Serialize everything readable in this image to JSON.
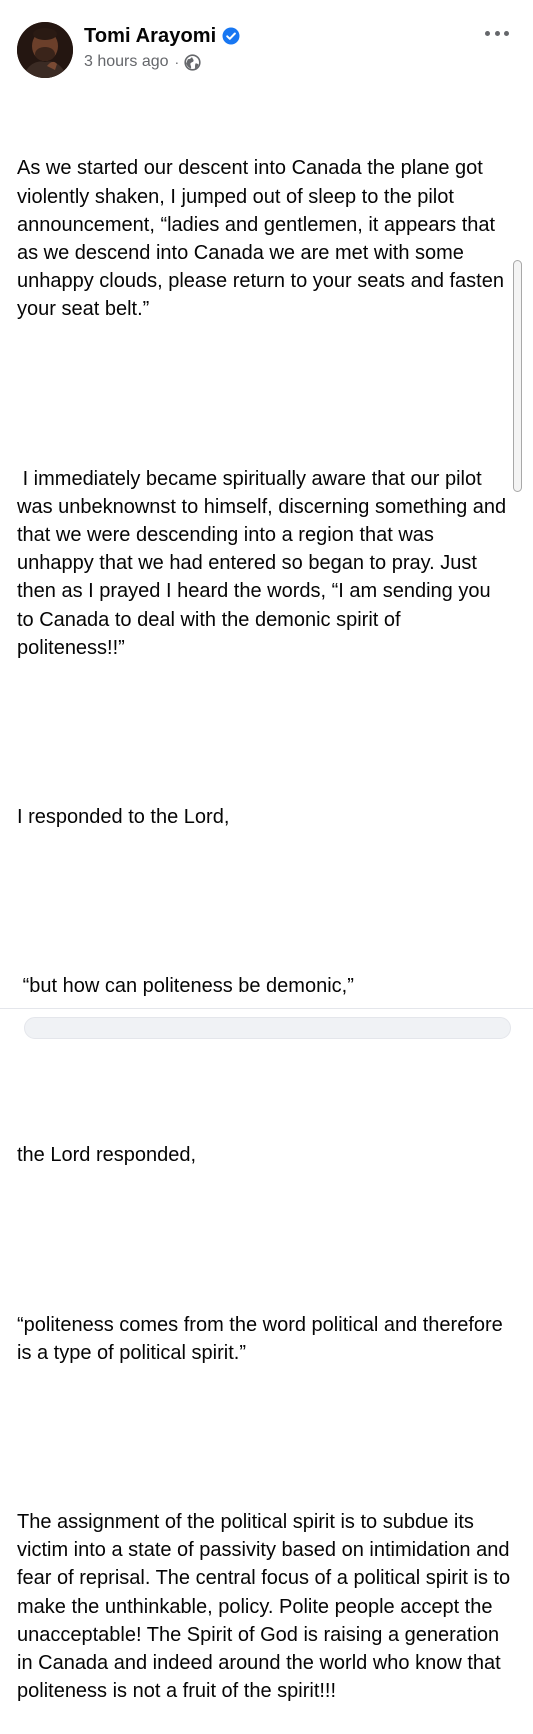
{
  "post": {
    "author": "Tomi Arayomi",
    "timestamp": "3 hours ago",
    "separator": "·",
    "verified_icon": "verified-badge-icon",
    "privacy_icon": "globe-icon",
    "paragraphs": [
      "As we started our descent into Canada the plane got violently shaken, I jumped out of sleep to the pilot announcement, “ladies and gentlemen, it appears that as we descend into Canada we are met with some unhappy clouds, please return to your seats and fasten your seat belt.”",
      " I immediately became spiritually aware that our pilot was unbeknownst to himself, discerning something and that we were descending into a region that was unhappy that we had entered so began to pray. Just then as I prayed I heard the words, “I am sending you to Canada to deal with the demonic spirit of politeness!!”",
      "I responded to the Lord,",
      " “but how can politeness be demonic,”",
      "the Lord responded,",
      "“politeness comes from the word political and therefore is a type of political spirit.”",
      "The assignment of the political spirit is to subdue its victim into a state of passivity based on intimidation and fear of reprisal. The central focus of a political spirit is to make the unthinkable, policy. Polite people accept the unacceptable! The Spirit of God is raising a generation in Canada and indeed around the world who know that politeness is not a fruit of the spirit!!!"
    ]
  },
  "colors": {
    "verified": "#1877f2",
    "meta_text": "#65676b",
    "body_text": "#050505"
  }
}
